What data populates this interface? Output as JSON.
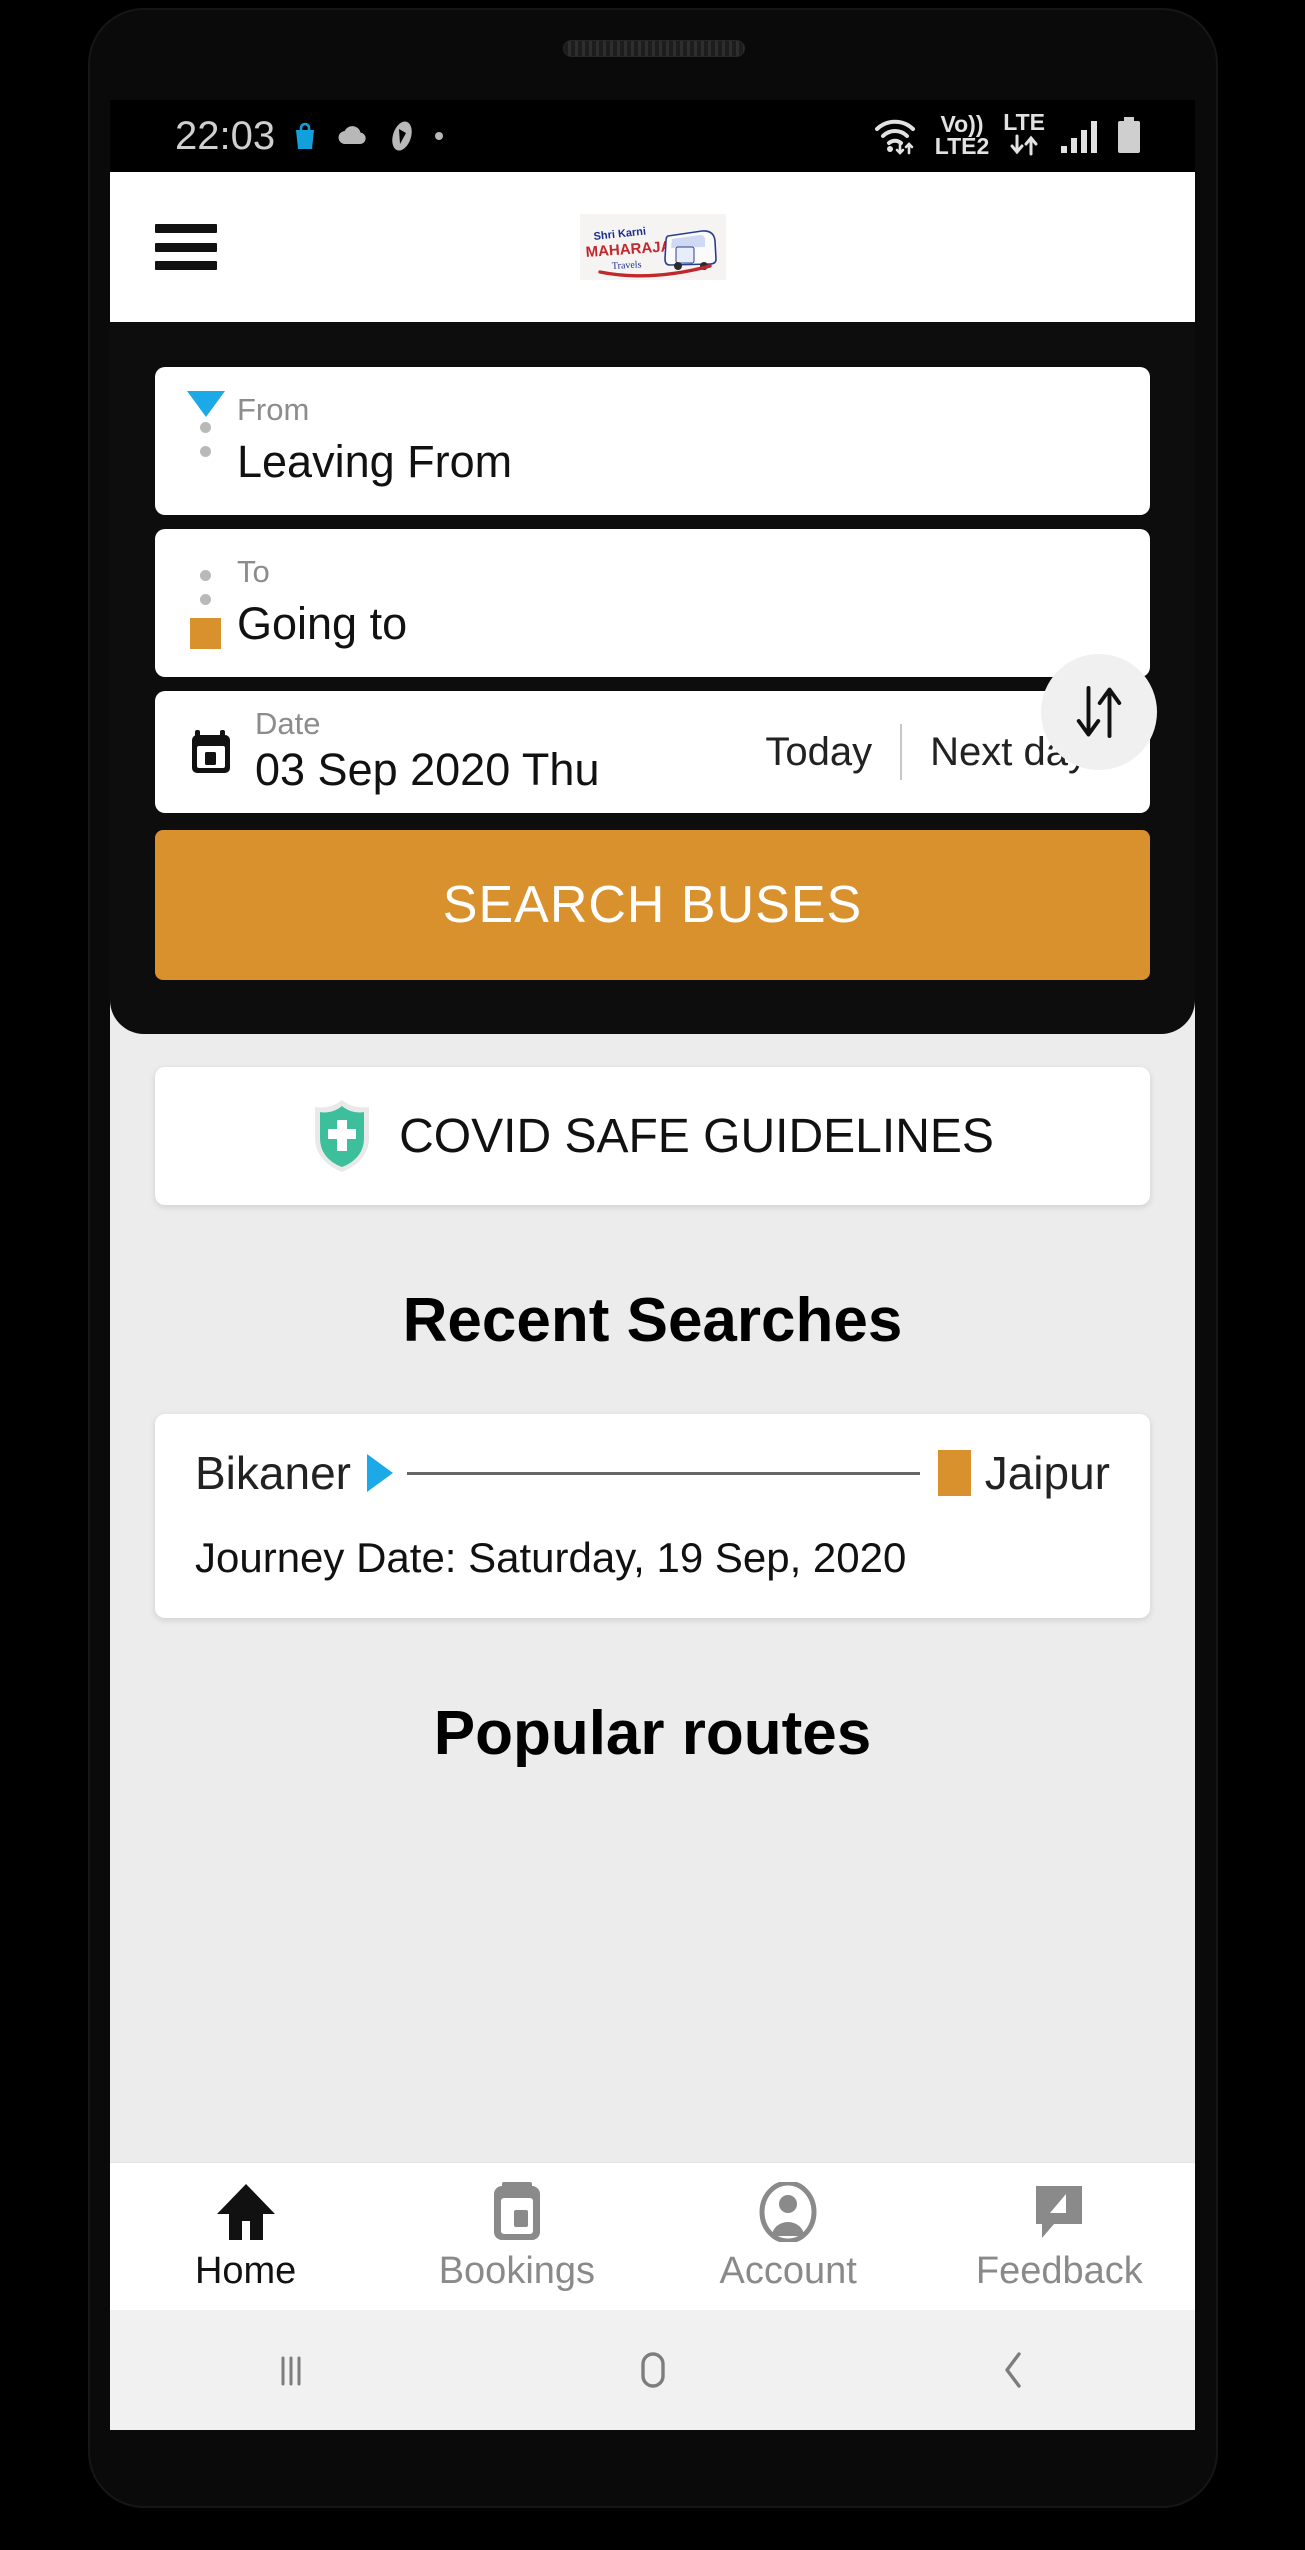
{
  "status_bar": {
    "time": "22:03",
    "left_icons": [
      "shopping-bag-icon",
      "cloud-icon",
      "app-icon",
      "dot-icon"
    ],
    "wifi_label": "wifi-icon",
    "volte_top": "Vo))",
    "volte_bottom": "LTE2",
    "lte_top": "LTE",
    "lte_bottom": "arrows",
    "signal_label": "signal-bars-icon",
    "battery_label": "battery-icon"
  },
  "header": {
    "menu_label": "menu",
    "logo_line1": "Shri Karni",
    "logo_line2": "MAHARAJA",
    "logo_line3": "Travels"
  },
  "search": {
    "from_label": "From",
    "from_placeholder": "Leaving From",
    "to_label": "To",
    "to_placeholder": "Going to",
    "swap_label": "swap",
    "date_label": "Date",
    "date_value": "03 Sep 2020 Thu",
    "today_label": "Today",
    "next_day_label": "Next day",
    "search_button": "SEARCH BUSES"
  },
  "covid": {
    "title": "COVID SAFE GUIDELINES"
  },
  "sections": {
    "recent_searches_title": "Recent Searches",
    "popular_routes_title": "Popular routes"
  },
  "recent_searches": [
    {
      "from": "Bikaner",
      "to": "Jaipur",
      "journey_date": "Journey Date: Saturday, 19 Sep, 2020"
    }
  ],
  "bottom_nav": [
    {
      "label": "Home",
      "icon": "home-icon",
      "active": true
    },
    {
      "label": "Bookings",
      "icon": "bookings-icon",
      "active": false
    },
    {
      "label": "Account",
      "icon": "account-icon",
      "active": false
    },
    {
      "label": "Feedback",
      "icon": "feedback-icon",
      "active": false
    }
  ],
  "system_nav": {
    "recents": "recents-icon",
    "home": "home-pill-icon",
    "back": "back-icon"
  },
  "colors": {
    "accent_orange": "#d9912e",
    "accent_blue": "#1ba9e8",
    "covid_green": "#3cbf9a",
    "panel_dark": "#0d0d0d",
    "page_bg": "#ececec"
  }
}
